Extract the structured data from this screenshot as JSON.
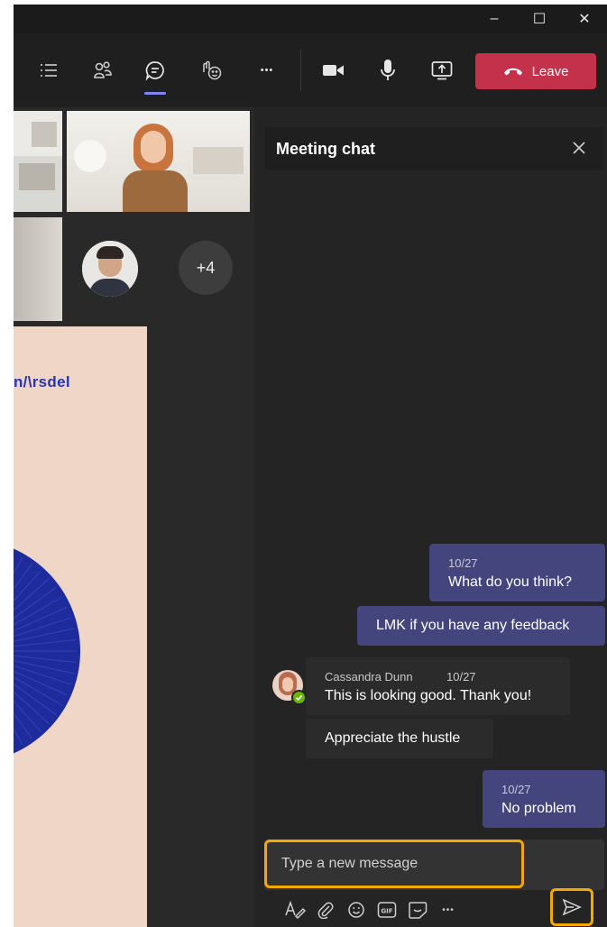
{
  "colors": {
    "accent": "#7f85f5",
    "leave": "#c4314b",
    "outgoing_bubble": "#45457e",
    "highlight": "#f4a800",
    "presence": "#6bb700"
  },
  "titlebar": {
    "minimize_glyph": "–",
    "maximize_glyph": "☐",
    "close_glyph": "✕"
  },
  "toolbar": {
    "icons": [
      "participants-list-icon",
      "people-icon",
      "chat-icon",
      "reactions-icon",
      "more-icon",
      "camera-icon",
      "microphone-icon",
      "share-screen-icon"
    ],
    "more_glyph": "•••",
    "leave_label": "Leave"
  },
  "stage": {
    "overflow_count": "+4",
    "slide_brand": "n/\\rsdel"
  },
  "chat": {
    "title": "Meeting chat",
    "messages": [
      {
        "timestamp": "10/27",
        "text": "What do you think?"
      },
      {
        "text": "LMK if you have any feedback"
      },
      {
        "author": "Cassandra Dunn",
        "timestamp": "10/27",
        "text": "This is looking good. Thank you!"
      },
      {
        "text": "Appreciate the hustle"
      },
      {
        "timestamp": "10/27",
        "text": "No problem"
      }
    ],
    "compose": {
      "placeholder": "Type a new message",
      "more_glyph": "•••",
      "gif_label": "GIF"
    }
  }
}
